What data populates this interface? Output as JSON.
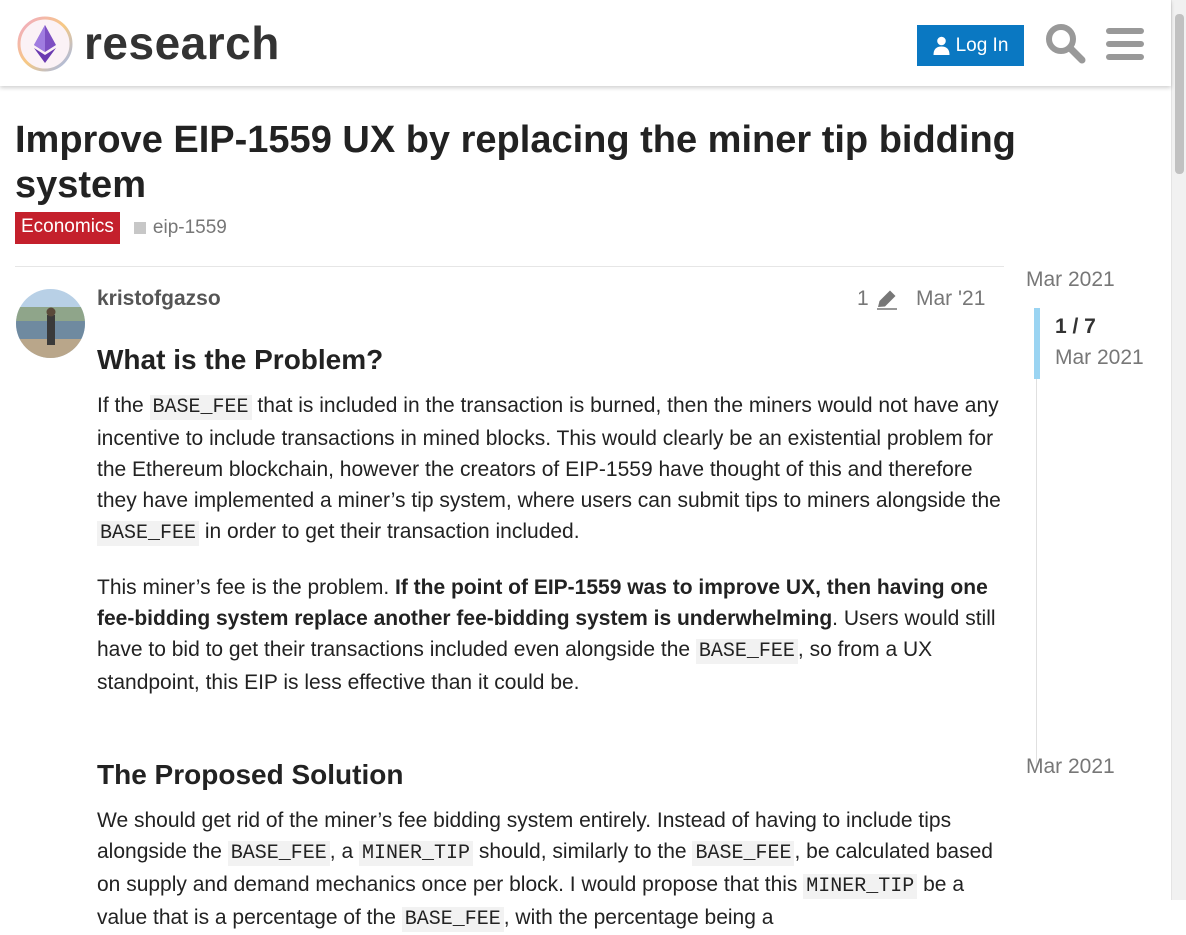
{
  "header": {
    "site_name": "research",
    "login_label": "Log In",
    "icons": {
      "login": "user-icon",
      "search": "search-icon",
      "menu": "hamburger-menu-icon",
      "logo": "ethereum-logo-icon"
    }
  },
  "topic": {
    "title": "Improve EIP-1559 UX by replacing the miner tip bidding system",
    "category": "Economics",
    "category_color": "#c4202c",
    "tag": "eip-1559"
  },
  "post": {
    "author": "kristofgazso",
    "edit_count": "1",
    "date": "Mar '21",
    "heading1": "What is the Problem?",
    "p1": {
      "t1": "If the ",
      "c1": "BASE_FEE",
      "t2": " that is included in the transaction is burned, then the miners would not have any incentive to include transactions in mined blocks. This would clearly be an existential problem for the Ethereum blockchain, however the creators of EIP-1559 have thought of this and therefore they have implemented a miner’s tip system, where users can submit tips to miners alongside the ",
      "c2": "BASE_FEE",
      "t3": " in order to get their transaction included."
    },
    "p2": {
      "t1": "This miner’s fee is the problem. ",
      "b1": "If the point of EIP-1559 was to improve UX, then having one fee-bidding system replace another fee-bidding system is underwhelming",
      "t2": ". Users would still have to bid to get their transactions included even alongside the ",
      "c1": "BASE_FEE",
      "t3": ", so from a UX standpoint, this EIP is less effective than it could be."
    },
    "heading2": "The Proposed Solution",
    "p3": {
      "t1": "We should get rid of the miner’s fee bidding system entirely. Instead of having to include tips alongside the ",
      "c1": "BASE_FEE",
      "t2": ", a ",
      "c2": "MINER_TIP",
      "t3": " should, similarly to the ",
      "c3": "BASE_FEE",
      "t4": ", be calculated based on supply and demand mechanics once per block. I would propose that this ",
      "c4": "MINER_TIP",
      "t5": " be a value that is a percentage of the ",
      "c5": "BASE_FEE",
      "t6": ", with the percentage being a"
    }
  },
  "timeline": {
    "start_date": "Mar 2021",
    "position": "1 / 7",
    "current_date": "Mar 2021",
    "end_date": "Mar 2021"
  },
  "colors": {
    "accent": "#0a78c2",
    "timeline_handle": "#9ad4f2"
  }
}
